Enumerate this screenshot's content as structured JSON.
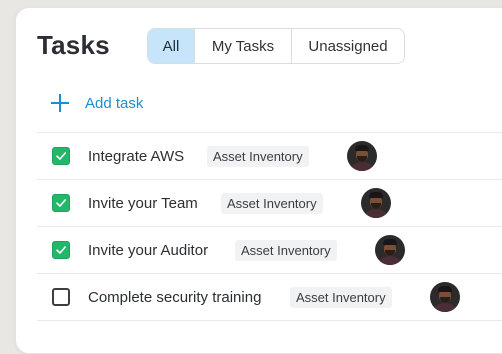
{
  "header": {
    "title": "Tasks"
  },
  "tabs": [
    {
      "label": "All",
      "active": true
    },
    {
      "label": "My Tasks",
      "active": false
    },
    {
      "label": "Unassigned",
      "active": false
    }
  ],
  "add_task": {
    "label": "Add task",
    "icon": "plus-icon"
  },
  "tasks": [
    {
      "name": "Integrate AWS",
      "badge": "Asset Inventory",
      "done": true
    },
    {
      "name": "Invite your Team",
      "badge": "Asset Inventory",
      "done": true
    },
    {
      "name": "Invite your Auditor",
      "badge": "Asset Inventory",
      "done": true
    },
    {
      "name": "Complete security training",
      "badge": "Asset Inventory",
      "done": false
    }
  ],
  "colors": {
    "accent": "#1a8fd1",
    "active_tab": "#c6e4fa",
    "check_on": "#23b76a"
  }
}
